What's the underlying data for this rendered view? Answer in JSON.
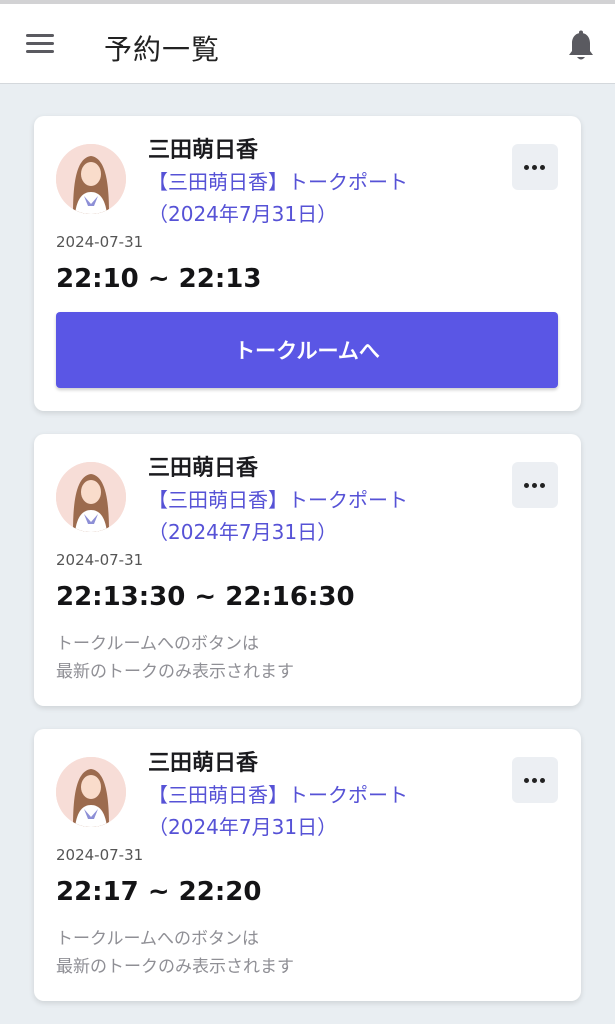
{
  "header": {
    "menu_icon": "hamburger-menu-icon",
    "title": "予約一覧",
    "bell_icon": "bell-icon"
  },
  "reservations": [
    {
      "talent_name": "三田萌日香",
      "event_line1": "【三田萌日香】トークポート",
      "event_line2": "（2024年7月31日）",
      "date": "2024-07-31",
      "time_range": "22:10 ~ 22:13",
      "action_label": "トークルームへ"
    },
    {
      "talent_name": "三田萌日香",
      "event_line1": "【三田萌日香】トークポート",
      "event_line2": "（2024年7月31日）",
      "date": "2024-07-31",
      "time_range": "22:13:30 ~ 22:16:30",
      "note_line1": "トークルームへのボタンは",
      "note_line2": "最新のトークのみ表示されます"
    },
    {
      "talent_name": "三田萌日香",
      "event_line1": "【三田萌日香】トークポート",
      "event_line2": "（2024年7月31日）",
      "date": "2024-07-31",
      "time_range": "22:17 ~ 22:20",
      "note_line1": "トークルームへのボタンは",
      "note_line2": "最新のトークのみ表示されます"
    }
  ],
  "colors": {
    "accent": "#5a56e5",
    "link": "#5652d6",
    "background": "#e9eef2"
  }
}
